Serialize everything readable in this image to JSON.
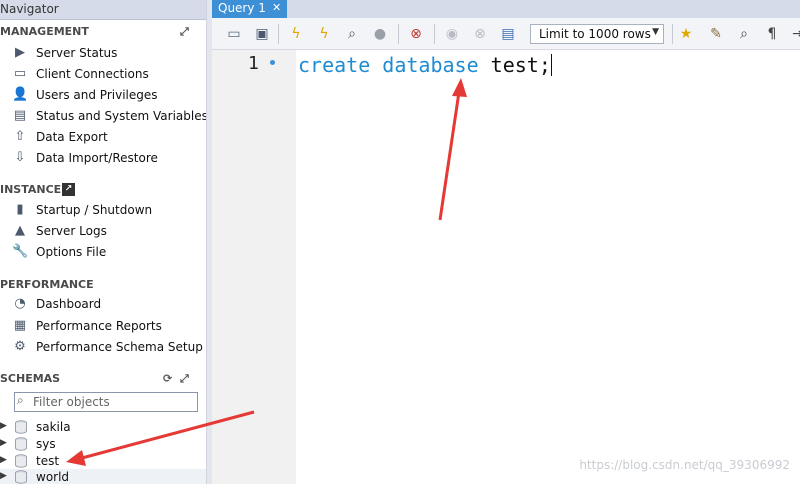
{
  "navigator": {
    "title": "Navigator",
    "management": {
      "header": "MANAGEMENT",
      "items": [
        {
          "label": "Server Status",
          "icon": "server-status-icon"
        },
        {
          "label": "Client Connections",
          "icon": "client-connections-icon"
        },
        {
          "label": "Users and Privileges",
          "icon": "user-icon"
        },
        {
          "label": "Status and System Variables",
          "icon": "monitor-icon"
        },
        {
          "label": "Data Export",
          "icon": "export-icon"
        },
        {
          "label": "Data Import/Restore",
          "icon": "import-icon"
        }
      ]
    },
    "instance": {
      "header": "INSTANCE",
      "items": [
        {
          "label": "Startup / Shutdown",
          "icon": "power-icon"
        },
        {
          "label": "Server Logs",
          "icon": "warning-icon"
        },
        {
          "label": "Options File",
          "icon": "wrench-icon"
        }
      ]
    },
    "performance": {
      "header": "PERFORMANCE",
      "items": [
        {
          "label": "Dashboard",
          "icon": "dashboard-icon"
        },
        {
          "label": "Performance Reports",
          "icon": "reports-icon"
        },
        {
          "label": "Performance Schema Setup",
          "icon": "gear-icon"
        }
      ]
    },
    "schemas": {
      "header": "SCHEMAS",
      "filter_placeholder": "Filter objects",
      "items": [
        {
          "name": "sakila"
        },
        {
          "name": "sys"
        },
        {
          "name": "test"
        },
        {
          "name": "world"
        }
      ]
    }
  },
  "editor": {
    "tab": {
      "label": "Query 1",
      "close": "✕"
    },
    "limit_rows": "Limit to 1000 rows",
    "line_number": "1",
    "code": {
      "kw1": "create",
      "kw2": "database",
      "ident": "test;"
    }
  },
  "watermark": "https://blog.csdn.net/qq_39306992",
  "colors": {
    "accent": "#3d8fd6",
    "keyword": "#1f8bd0",
    "annotation_arrow": "#e53935"
  }
}
